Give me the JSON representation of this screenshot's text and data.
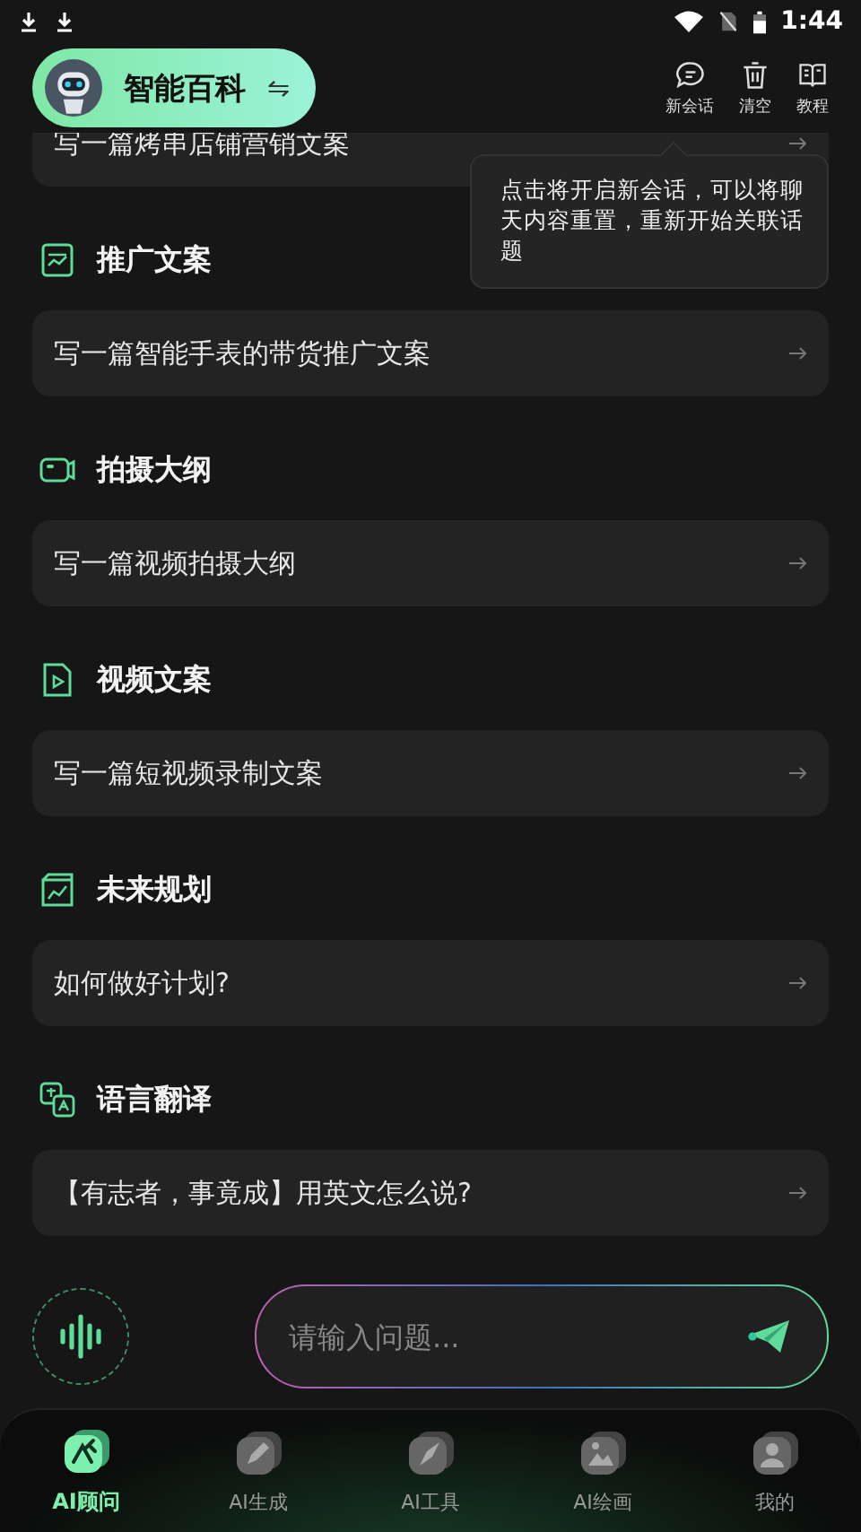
{
  "status_bar": {
    "time": "1:44"
  },
  "header": {
    "title": "智能百科",
    "switch_glyph": "⇋",
    "actions": [
      {
        "kind": "chat",
        "label": "新会话"
      },
      {
        "kind": "trash",
        "label": "清空"
      },
      {
        "kind": "book",
        "label": "教程"
      }
    ]
  },
  "tooltip": "点击将开启新会话，可以将聊天内容重置，重新开始关联话题",
  "partial_prompt": "写一篇烤串店铺营销文案",
  "sections": [
    {
      "kind": "chart",
      "title": "推广文案",
      "prompt": "写一篇智能手表的带货推广文案"
    },
    {
      "kind": "camera",
      "title": "拍摄大纲",
      "prompt": "写一篇视频拍摄大纲"
    },
    {
      "kind": "video",
      "title": "视频文案",
      "prompt": "写一篇短视频录制文案"
    },
    {
      "kind": "plan",
      "title": "未来规划",
      "prompt": "如何做好计划?"
    },
    {
      "kind": "translate",
      "title": "语言翻译",
      "prompt": "【有志者，事竟成】用英文怎么说?"
    }
  ],
  "input": {
    "placeholder": "请输入问题..."
  },
  "tabs": [
    {
      "kind": "advisor",
      "label": "AI顾问",
      "selected": true
    },
    {
      "kind": "pen",
      "label": "AI生成",
      "selected": false
    },
    {
      "kind": "compass",
      "label": "AI工具",
      "selected": false
    },
    {
      "kind": "image",
      "label": "AI绘画",
      "selected": false
    },
    {
      "kind": "user",
      "label": "我的",
      "selected": false
    }
  ]
}
